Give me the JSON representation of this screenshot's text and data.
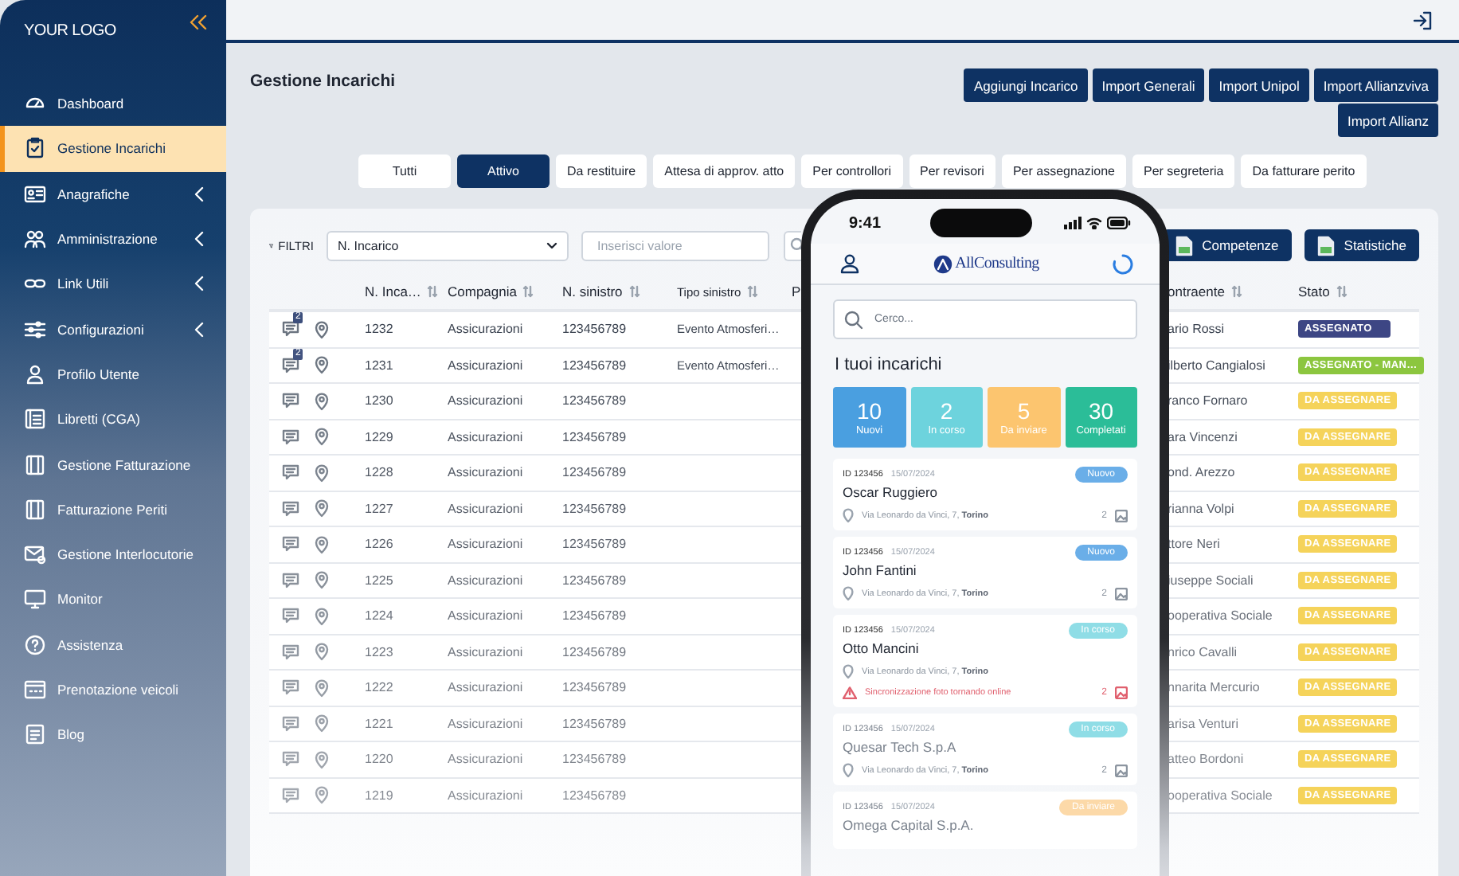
{
  "sidebar": {
    "logo": "YOUR LOGO",
    "items": [
      {
        "label": "Dashboard",
        "selected": false,
        "expandable": false
      },
      {
        "label": "Gestione Incarichi",
        "selected": true,
        "expandable": false
      },
      {
        "label": "Anagrafiche",
        "selected": false,
        "expandable": true
      },
      {
        "label": "Amministrazione",
        "selected": false,
        "expandable": true
      },
      {
        "label": "Link Utili",
        "selected": false,
        "expandable": true
      },
      {
        "label": "Configurazioni",
        "selected": false,
        "expandable": true
      },
      {
        "label": "Profilo Utente",
        "selected": false,
        "expandable": false
      },
      {
        "label": "Libretti (CGA)",
        "selected": false,
        "expandable": false
      },
      {
        "label": "Gestione Fatturazione",
        "selected": false,
        "expandable": false
      },
      {
        "label": "Fatturazione Periti",
        "selected": false,
        "expandable": false
      },
      {
        "label": "Gestione Interlocutorie",
        "selected": false,
        "expandable": false
      },
      {
        "label": "Monitor",
        "selected": false,
        "expandable": false
      },
      {
        "label": "Assistenza",
        "selected": false,
        "expandable": false
      },
      {
        "label": "Prenotazione veicoli",
        "selected": false,
        "expandable": false
      },
      {
        "label": "Blog",
        "selected": false,
        "expandable": false
      }
    ]
  },
  "header": {
    "title": "Gestione Incarichi",
    "buttons": [
      "Aggiungi Incarico",
      "Import Generali",
      "Import Unipol",
      "Import Allianzviva",
      "Import Allianz"
    ]
  },
  "tabs": [
    {
      "label": "Tutti",
      "selected": false
    },
    {
      "label": "Attivo",
      "selected": true
    },
    {
      "label": "Da restituire",
      "selected": false
    },
    {
      "label": "Attesa di approv. atto",
      "selected": false
    },
    {
      "label": "Per controllori",
      "selected": false
    },
    {
      "label": "Per revisori",
      "selected": false
    },
    {
      "label": "Per assegnazione",
      "selected": false
    },
    {
      "label": "Per segreteria",
      "selected": false
    },
    {
      "label": "Da fatturare perito",
      "selected": false
    }
  ],
  "filters": {
    "label": "FILTRI",
    "field": {
      "value": "N. Incarico"
    },
    "search": {
      "placeholder": "Inserisci valore"
    },
    "exports": [
      "Competenze",
      "Statistiche"
    ]
  },
  "table": {
    "columns": [
      "N. Inca…",
      "Compagnia",
      "N. sinistro",
      "Tipo sinistro",
      "P",
      "ontraente",
      "Stato"
    ],
    "rows": [
      {
        "badge": "2",
        "number": "1232",
        "company": "Assicurazioni",
        "claim": "123456789",
        "type": "Evento Atmosferi…",
        "client": "ario Rossi",
        "status": {
          "label": "ASSEGNATO",
          "color": "#3d4684"
        }
      },
      {
        "badge": "2",
        "number": "1231",
        "company": "Assicurazioni",
        "claim": "123456789",
        "type": "Evento Atmosferi…",
        "client": "ilberto Cangialosi",
        "status": {
          "label": "ASSEGNATO - MAN…",
          "color": "#8cc63f"
        }
      },
      {
        "number": "1230",
        "company": "Assicurazioni",
        "claim": "123456789",
        "client": "ranco Fornaro",
        "status": {
          "label": "DA ASSEGNARE",
          "color": "#f5d35a"
        }
      },
      {
        "number": "1229",
        "company": "Assicurazioni",
        "claim": "123456789",
        "client": "ara Vincenzi",
        "status": {
          "label": "DA ASSEGNARE",
          "color": "#f5d35a"
        }
      },
      {
        "number": "1228",
        "company": "Assicurazioni",
        "claim": "123456789",
        "client": "ond. Arezzo",
        "status": {
          "label": "DA ASSEGNARE",
          "color": "#f5d35a"
        }
      },
      {
        "number": "1227",
        "company": "Assicurazioni",
        "claim": "123456789",
        "client": "rianna Volpi",
        "status": {
          "label": "DA ASSEGNARE",
          "color": "#f5d35a"
        }
      },
      {
        "number": "1226",
        "company": "Assicurazioni",
        "claim": "123456789",
        "client": "ttore Neri",
        "status": {
          "label": "DA ASSEGNARE",
          "color": "#f5d35a"
        }
      },
      {
        "number": "1225",
        "company": "Assicurazioni",
        "claim": "123456789",
        "client": "iuseppe Sociali",
        "status": {
          "label": "DA ASSEGNARE",
          "color": "#f5d35a"
        }
      },
      {
        "number": "1224",
        "company": "Assicurazioni",
        "claim": "123456789",
        "client": "ooperativa Sociale",
        "status": {
          "label": "DA ASSEGNARE",
          "color": "#f5d35a"
        }
      },
      {
        "number": "1223",
        "company": "Assicurazioni",
        "claim": "123456789",
        "client": "nrico Cavalli",
        "status": {
          "label": "DA ASSEGNARE",
          "color": "#f5d35a"
        }
      },
      {
        "number": "1222",
        "company": "Assicurazioni",
        "claim": "123456789",
        "client": "nnarita Mercurio",
        "status": {
          "label": "DA ASSEGNARE",
          "color": "#f5d35a"
        }
      },
      {
        "number": "1221",
        "company": "Assicurazioni",
        "claim": "123456789",
        "client": "arisa Venturi",
        "status": {
          "label": "DA ASSEGNARE",
          "color": "#f5d35a"
        }
      },
      {
        "number": "1220",
        "company": "Assicurazioni",
        "claim": "123456789",
        "client": "atteo Bordoni",
        "status": {
          "label": "DA ASSEGNARE",
          "color": "#f5d35a"
        }
      },
      {
        "number": "1219",
        "company": "Assicurazioni",
        "claim": "123456789",
        "client": "ooperativa Sociale",
        "status": {
          "label": "DA ASSEGNARE",
          "color": "#f5d35a"
        }
      }
    ]
  },
  "phone": {
    "time": "9:41",
    "brand": "AllConsulting",
    "search": {
      "placeholder": "Cerco..."
    },
    "heading": "I tuoi incarichi",
    "stats": [
      {
        "value": "10",
        "label": "Nuovi",
        "color": "#4a9fe0"
      },
      {
        "value": "2",
        "label": "In corso",
        "color": "#6dd3dd"
      },
      {
        "value": "5",
        "label": "Da inviare",
        "color": "#fcc56f"
      },
      {
        "value": "30",
        "label": "Completati",
        "color": "#2bbd98"
      }
    ],
    "cards": [
      {
        "id": "ID 123456",
        "date": "15/07/2024",
        "name": "Oscar Ruggiero",
        "status": {
          "label": "Nuovo",
          "color": "#6aaee8"
        },
        "address": "Via Leonardo da Vinci, 7, **Torino**",
        "photos": "2"
      },
      {
        "id": "ID 123456",
        "date": "15/07/2024",
        "name": "John Fantini",
        "status": {
          "label": "Nuovo",
          "color": "#6aaee8"
        },
        "address": "Via Leonardo da Vinci, 7, **Torino**",
        "photos": "2"
      },
      {
        "id": "ID 123456",
        "date": "15/07/2024",
        "name": "Otto Mancini",
        "status": {
          "label": "In corso",
          "color": "#8fdde6"
        },
        "address": "Via Leonardo da Vinci, 7, **Torino**",
        "warning": "Sincronizzazione foto tornando online",
        "photos": "2"
      },
      {
        "id": "ID 123456",
        "date": "15/07/2024",
        "name": "Quesar Tech S.p.A",
        "status": {
          "label": "In corso",
          "color": "#8fdde6"
        },
        "address": "Via Leonardo da Vinci, 7, **Torino**",
        "photos": "2"
      },
      {
        "id": "ID 123456",
        "date": "15/07/2024",
        "name": "Omega Capital S.p.A.",
        "status": {
          "label": "Da inviare",
          "color": "#fcd9a8"
        }
      }
    ]
  }
}
